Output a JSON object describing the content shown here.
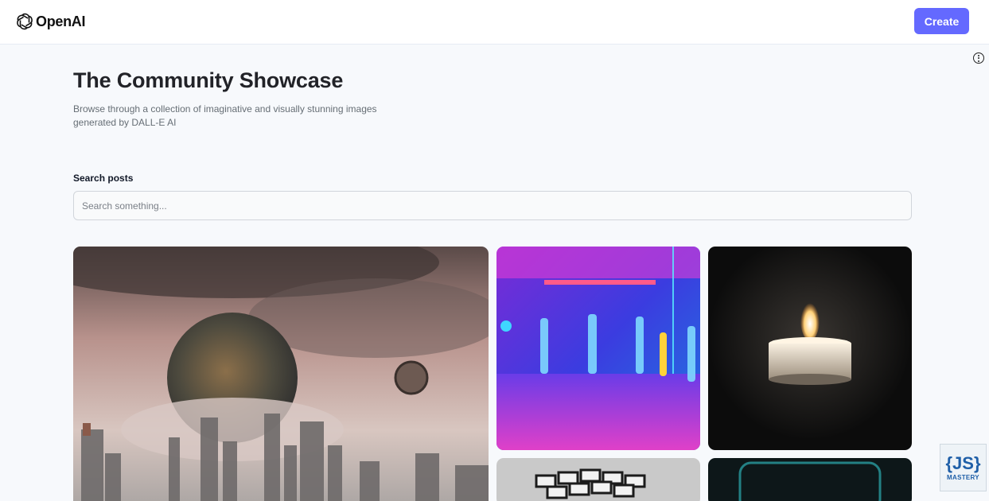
{
  "header": {
    "brand": "OpenAI",
    "create_label": "Create"
  },
  "hero": {
    "title": "The Community Showcase",
    "subtitle": "Browse through a collection of imaginative and visually stunning images generated by DALL-E AI"
  },
  "search": {
    "label": "Search posts",
    "placeholder": "Search something...",
    "value": ""
  },
  "gallery": {
    "cards": [
      {
        "subject": "apocalyptic city with shattered earth"
      },
      {
        "subject": "neon dance club with dancers"
      },
      {
        "subject": "candle in the dark"
      },
      {
        "subject": "rubik's cube"
      },
      {
        "subject": "glowing teal screen"
      }
    ]
  },
  "watermark": {
    "logo_text": "{JS}",
    "label": "MASTERY"
  },
  "colors": {
    "accent": "#6469ff",
    "page_bg": "#f7f9fc",
    "title": "#222328",
    "subtitle": "#666e75"
  },
  "icons": [
    "openai-logo-icon",
    "more-options-icon"
  ]
}
